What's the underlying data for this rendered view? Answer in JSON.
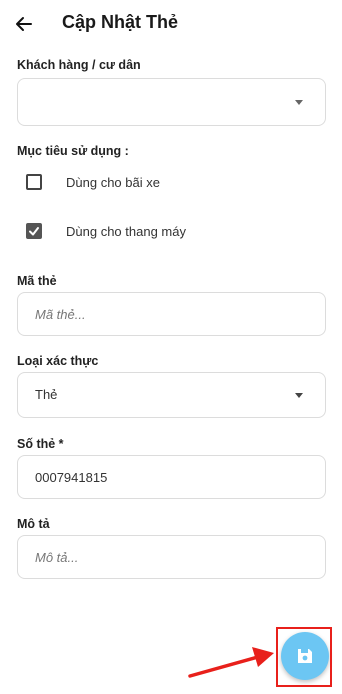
{
  "header": {
    "title": "Cập Nhật Thẻ",
    "back_icon": "arrow-left-icon"
  },
  "customer": {
    "label": "Khách hàng / cư dân",
    "value": ""
  },
  "purpose": {
    "label": "Mục tiêu sử dụng :",
    "options": [
      {
        "label": "Dùng cho bãi xe",
        "checked": false
      },
      {
        "label": "Dùng cho thang máy",
        "checked": true
      }
    ]
  },
  "card_code": {
    "label": "Mã thẻ",
    "placeholder": "Mã thẻ..."
  },
  "auth_type": {
    "label": "Loại xác thực",
    "value": "Thẻ"
  },
  "card_number": {
    "label": "Số thẻ *",
    "value": "0007941815"
  },
  "description": {
    "label": "Mô tả",
    "placeholder": "Mô tả..."
  },
  "save_fab": {
    "icon": "floppy-disk-icon",
    "color": "#6cc6f3"
  },
  "annotation": {
    "highlight_color": "#e8201b"
  }
}
